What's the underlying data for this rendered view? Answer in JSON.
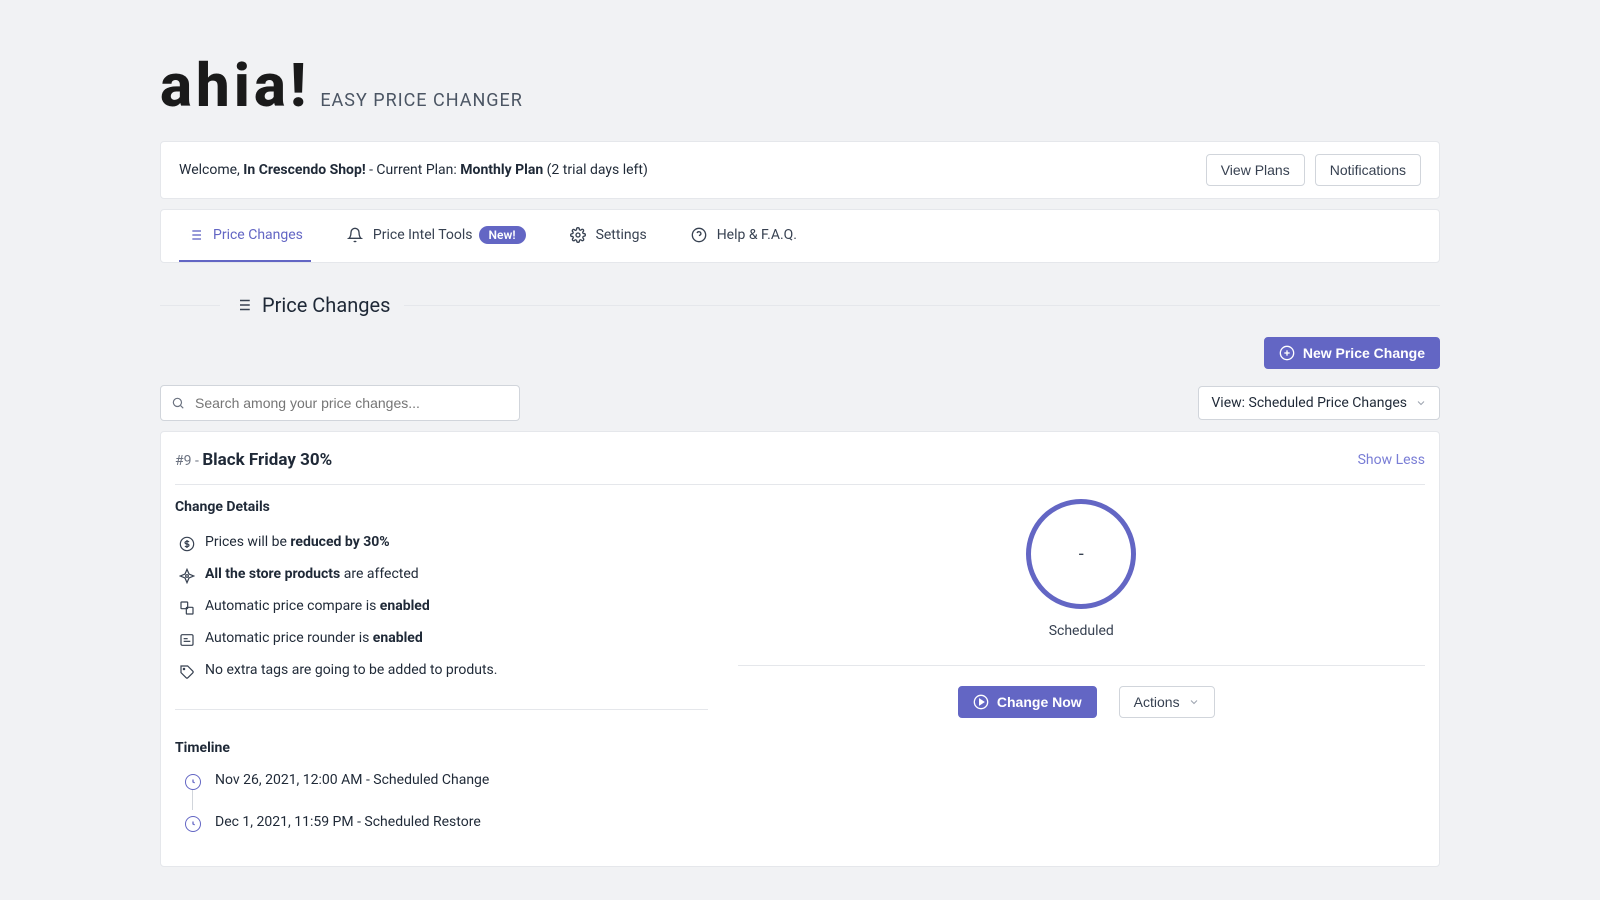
{
  "brand": {
    "logo": "ahia!",
    "tagline": "EASY PRICE CHANGER"
  },
  "welcome": {
    "prefix": "Welcome, ",
    "shop": "In Crescendo Shop!",
    "plan_prefix": " - Current Plan: ",
    "plan": "Monthly Plan",
    "trial": " (2 trial days left)",
    "view_plans": "View Plans",
    "notifications": "Notifications"
  },
  "nav": {
    "price_changes": "Price Changes",
    "intel": "Price Intel Tools",
    "intel_badge": "New!",
    "settings": "Settings",
    "help": "Help & F.A.Q."
  },
  "section": {
    "title": "Price Changes"
  },
  "toolbar": {
    "new_btn": "New Price Change",
    "search_placeholder": "Search among your price changes...",
    "view_label": "View: Scheduled Price Changes"
  },
  "change": {
    "id": "#9",
    "sep": " - ",
    "name": "Black Friday 30%",
    "show_less": "Show Less",
    "details_heading": "Change Details",
    "d1_a": "Prices will be ",
    "d1_b": "reduced by 30%",
    "d2_a": "All the store products",
    "d2_b": " are affected",
    "d3_a": "Automatic price compare is ",
    "d3_b": "enabled",
    "d4_a": "Automatic price rounder is ",
    "d4_b": "enabled",
    "d5": "No extra tags are going to be added to produts.",
    "timeline_heading": "Timeline",
    "t1": "Nov 26, 2021, 12:00 AM - Scheduled Change",
    "t2": "Dec 1, 2021, 11:59 PM - Scheduled Restore",
    "ring_value": "-",
    "status": "Scheduled",
    "change_now": "Change Now",
    "actions": "Actions"
  }
}
